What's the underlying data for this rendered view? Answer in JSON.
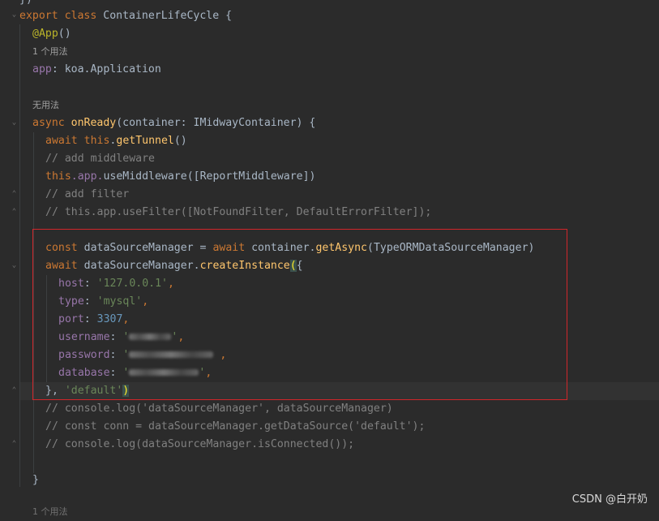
{
  "editor": {
    "hints": {
      "usages_one": "1 个用法",
      "no_usages": "无用法",
      "usages_bottom": "1 个用法"
    },
    "tokens": {
      "close_prev": "})",
      "export": "export",
      "class": "class",
      "class_name": "ContainerLifeCycle",
      "brace_open": " {",
      "decorator": "@App",
      "decorator_parens": "()",
      "app_prop": "app",
      "app_type": ": koa.Application",
      "async": "async",
      "on_ready": "onReady",
      "on_ready_params": "(container: IMidwayContainer) {",
      "await": "await",
      "this": "this",
      "get_tunnel": "getTunnel",
      "call_parens": "()",
      "comment_middleware": "// add middleware",
      "use_middleware_obj": ".app.",
      "use_middleware": "useMiddleware",
      "use_middleware_args": "([ReportMiddleware])",
      "comment_filter": "// add filter",
      "comment_use_filter": "// this.app.useFilter([NotFoundFilter, DefaultErrorFilter]);",
      "const": "const",
      "dsm_decl": " dataSourceManager = ",
      "container_dot": " container.",
      "get_async": "getAsync",
      "get_async_args": "(TypeORMDataSourceManager)",
      "dsm_dot": " dataSourceManager.",
      "create_instance": "createInstance",
      "paren_open": "(",
      "brace_after": "{",
      "host_key": "host",
      "host_val": "'127.0.0.1'",
      "type_key": "type",
      "type_val": "'mysql'",
      "port_key": "port",
      "port_val": "3307",
      "username_key": "username",
      "password_key": "password",
      "database_key": "database",
      "quote": "'",
      "comma": ",",
      "colon": ": ",
      "close_obj": "}, ",
      "default_val": "'default'",
      "paren_close": ")",
      "comment_log1": "// console.log('dataSourceManager', dataSourceManager)",
      "comment_conn": "// const conn = dataSourceManager.getDataSource('default');",
      "comment_log2": "// console.log(dataSourceManager.isConnected());",
      "method_close": "}"
    }
  },
  "watermark": "CSDN @白开奶"
}
